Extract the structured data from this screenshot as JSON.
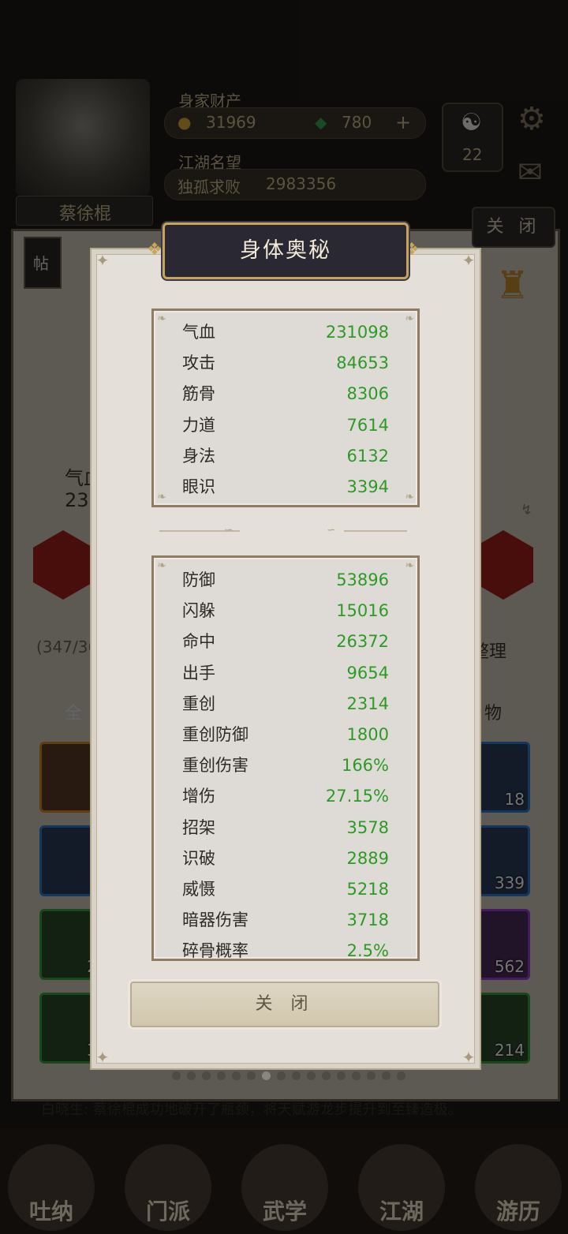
{
  "background": {
    "wealth_label": "身家财产",
    "gold_amount": "31969",
    "jade_amount": "780",
    "add_symbol": "+",
    "fame_label": "江湖名望",
    "fame_title": "独孤求败",
    "fame_value": "2983356",
    "level_badge": "22",
    "player_name": "蔡徐棍",
    "post_label": "帖",
    "close_label": "关 闭",
    "stat_partial_label": "气血",
    "stat_partial_value": "23",
    "inventory_count": "(347/36",
    "sort_label": "整理",
    "filter_all": "全",
    "filter_item": "物",
    "item_counts": [
      "18",
      "339",
      "562",
      "214"
    ],
    "left_item_counts": [
      "2",
      "3"
    ],
    "scroll_text": "白晓生: 蔡徐棍成功地破开了瓶颈，将天赋游龙步提升到至臻造极。",
    "nav": [
      "吐纳",
      "门派",
      "武学",
      "江湖",
      "游历"
    ]
  },
  "modal": {
    "title": "身体奥秘",
    "primary_stats": [
      {
        "label": "气血",
        "value": "231098"
      },
      {
        "label": "攻击",
        "value": "84653"
      },
      {
        "label": "筋骨",
        "value": "8306"
      },
      {
        "label": "力道",
        "value": "7614"
      },
      {
        "label": "身法",
        "value": "6132"
      },
      {
        "label": "眼识",
        "value": "3394"
      }
    ],
    "secondary_stats": [
      {
        "label": "防御",
        "value": "53896"
      },
      {
        "label": "闪躲",
        "value": "15016"
      },
      {
        "label": "命中",
        "value": "26372"
      },
      {
        "label": "出手",
        "value": "9654"
      },
      {
        "label": "重创",
        "value": "2314"
      },
      {
        "label": "重创防御",
        "value": "1800"
      },
      {
        "label": "重创伤害",
        "value": "166%"
      },
      {
        "label": "增伤",
        "value": "27.15%"
      },
      {
        "label": "招架",
        "value": "3578"
      },
      {
        "label": "识破",
        "value": "2889"
      },
      {
        "label": "威慑",
        "value": "5218"
      },
      {
        "label": "暗器伤害",
        "value": "3718"
      },
      {
        "label": "碎骨概率",
        "value": "2.5%"
      }
    ],
    "close_label": "关 闭"
  },
  "page_indicator": {
    "total": 16,
    "active": 7
  },
  "colors": {
    "stat_value": "#2e9a26",
    "title_bg": "#2a2833",
    "title_border": "#c7a35c"
  }
}
